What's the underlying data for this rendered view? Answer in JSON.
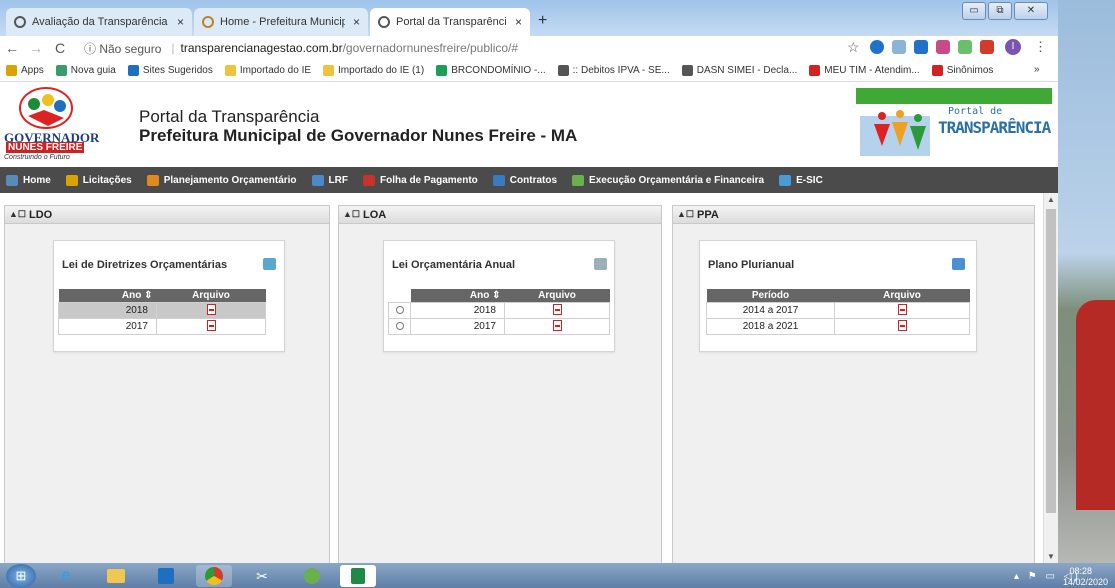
{
  "browser": {
    "tabs": [
      {
        "title": "Avaliação da Transparência dos M",
        "close": "×"
      },
      {
        "title": "Home - Prefeitura Municipal de G",
        "close": "×"
      },
      {
        "title": "Portal da Transparência",
        "close": "×"
      }
    ],
    "new_tab": "+",
    "window_buttons": [
      "▭",
      "⧉",
      "✕"
    ],
    "nav": {
      "back": "←",
      "forward": "→",
      "reload": "C"
    },
    "security": "ⓘ Não seguro",
    "url_host": "transparencianagestao.com.br",
    "url_path": "/governadornunesfreire/publico/#",
    "star": "☆",
    "profile": "I",
    "menu": "⋮",
    "bookmarks": [
      {
        "label": "Apps",
        "color": "#d9a400"
      },
      {
        "label": "Nova guia",
        "color": "#3a9b6e"
      },
      {
        "label": "Sites Sugeridos",
        "color": "#1e6fc0"
      },
      {
        "label": "Importado do IE",
        "color": "#f0c33c"
      },
      {
        "label": "Importado do IE (1)",
        "color": "#f0c33c"
      },
      {
        "label": "BRCONDOMÍNIO -...",
        "color": "#1a9e5a"
      },
      {
        "label": ":: Debitos IPVA - SE...",
        "color": "#555555"
      },
      {
        "label": "DASN SIMEI - Decla...",
        "color": "#555555"
      },
      {
        "label": "MEU TIM - Atendim...",
        "color": "#d22222"
      },
      {
        "label": "Sinônimos",
        "color": "#d22222"
      }
    ],
    "bookmarks_more": "»"
  },
  "header": {
    "title": "Portal da Transparência",
    "subtitle": "Prefeitura Municipal de Governador Nunes Freire - MA",
    "logo_text_1": "GOVERNADOR",
    "logo_text_2": "NUNES FREIRE",
    "logo_text_3": "Construindo o Futuro",
    "portal_logo_1": "Portal de",
    "portal_logo_2": "TRANSPARÊNCIA"
  },
  "menu": [
    {
      "label": "Home",
      "color": "#5a8ab8"
    },
    {
      "label": "Licitações",
      "color": "#d9a400"
    },
    {
      "label": "Planejamento Orçamentário",
      "color": "#e08a1e"
    },
    {
      "label": "LRF",
      "color": "#4a8ac8"
    },
    {
      "label": "Folha de Pagamento",
      "color": "#c8322c"
    },
    {
      "label": "Contratos",
      "color": "#3a7ac0"
    },
    {
      "label": "Execução Orçamentária e Financeira",
      "color": "#6ab04c"
    },
    {
      "label": "E-SIC",
      "color": "#4a9ad8"
    }
  ],
  "panels": {
    "ldo": {
      "header": "LDO",
      "box_title": "Lei de Diretrizes Orçamentárias",
      "col1": "Ano ⇕",
      "col2": "Arquivo",
      "rows": [
        {
          "year": "2018"
        },
        {
          "year": "2017"
        }
      ]
    },
    "loa": {
      "header": "LOA",
      "box_title": "Lei Orçamentária Anual",
      "col1": "Ano ⇕",
      "col2": "Arquivo",
      "rows": [
        {
          "year": "2018"
        },
        {
          "year": "2017"
        }
      ]
    },
    "ppa": {
      "header": "PPA",
      "box_title": "Plano Plurianual",
      "col1": "Período",
      "col2": "Arquivo",
      "rows": [
        {
          "period": "2014 a 2017"
        },
        {
          "period": "2018 a 2021"
        }
      ]
    },
    "panel_control": "▲☐"
  },
  "taskbar": {
    "time": "08:28",
    "date": "14/02/2020",
    "tray_icons": "▴ ⚑ ▭ ◁)"
  }
}
